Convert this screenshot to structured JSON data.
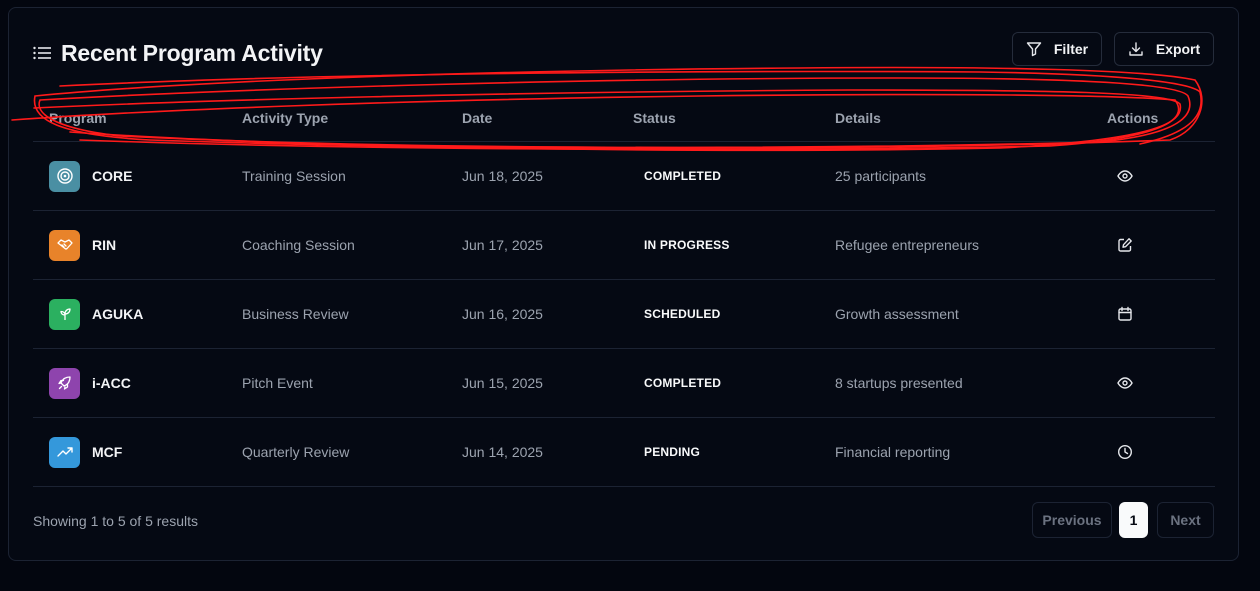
{
  "header": {
    "title": "Recent Program Activity",
    "filter_label": "Filter",
    "export_label": "Export"
  },
  "table": {
    "columns": [
      "Program",
      "Activity Type",
      "Date",
      "Status",
      "Details",
      "Actions"
    ],
    "rows": [
      {
        "program": "CORE",
        "icon": "target-icon",
        "icon_color": "#4a8fa3",
        "activity": "Training Session",
        "date": "Jun 18, 2025",
        "status": "COMPLETED",
        "details": "25 participants",
        "action_icon": "eye-icon"
      },
      {
        "program": "RIN",
        "icon": "handshake-icon",
        "icon_color": "#e8832a",
        "activity": "Coaching Session",
        "date": "Jun 17, 2025",
        "status": "IN PROGRESS",
        "details": "Refugee entrepreneurs",
        "action_icon": "edit-icon"
      },
      {
        "program": "AGUKA",
        "icon": "seedling-icon",
        "icon_color": "#2bb060",
        "activity": "Business Review",
        "date": "Jun 16, 2025",
        "status": "SCHEDULED",
        "details": "Growth assessment",
        "action_icon": "calendar-icon"
      },
      {
        "program": "i-ACC",
        "icon": "rocket-icon",
        "icon_color": "#8e44ad",
        "activity": "Pitch Event",
        "date": "Jun 15, 2025",
        "status": "COMPLETED",
        "details": "8 startups presented",
        "action_icon": "eye-icon"
      },
      {
        "program": "MCF",
        "icon": "trend-up-icon",
        "icon_color": "#3498db",
        "activity": "Quarterly Review",
        "date": "Jun 14, 2025",
        "status": "PENDING",
        "details": "Financial reporting",
        "action_icon": "clock-icon"
      }
    ]
  },
  "footer": {
    "showing_text": "Showing 1 to 5 of 5 results",
    "prev_label": "Previous",
    "current_page": "1",
    "next_label": "Next"
  },
  "colors": {
    "background": "#03060f",
    "card": "#050913",
    "annotation_scribble": "#ff1a1a"
  }
}
